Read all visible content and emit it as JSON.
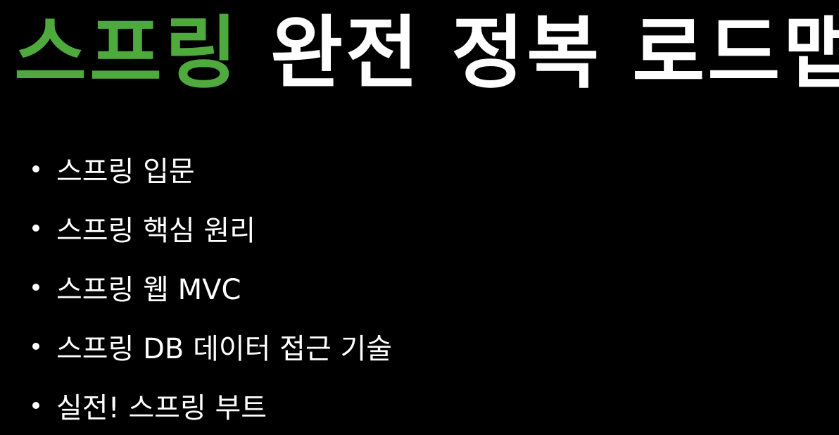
{
  "title": {
    "accent_text": "스프링",
    "rest_text": "완전 정복 로드맵",
    "accent_color": "#4faa3d",
    "text_color": "#ffffff"
  },
  "background_color": "#000000",
  "bullets": [
    "스프링 입문",
    "스프링 핵심 원리",
    "스프링 웹 MVC",
    "스프링 DB 데이터 접근 기술",
    "실전! 스프링 부트"
  ]
}
